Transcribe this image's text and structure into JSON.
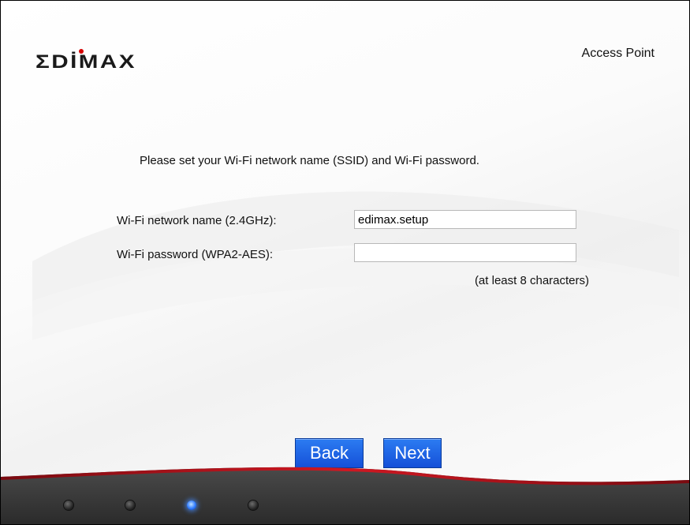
{
  "header": {
    "brand": "EDIMAX",
    "product": "Access Point"
  },
  "form": {
    "instruction": "Please set your Wi-Fi network name (SSID) and Wi-Fi password.",
    "ssid_label": "Wi-Fi network name (2.4GHz):",
    "ssid_value": "edimax.setup",
    "password_label": "Wi-Fi password (WPA2-AES):",
    "password_value": "",
    "password_hint": "(at least 8 characters)"
  },
  "buttons": {
    "back": "Back",
    "next": "Next"
  },
  "progress": {
    "total_steps": 4,
    "current_step": 3
  },
  "colors": {
    "button_blue": "#1a5fe6",
    "footer_dark": "#3a3a3a",
    "footer_accent_red": "#b5121b",
    "active_dot": "#2f7bff"
  }
}
